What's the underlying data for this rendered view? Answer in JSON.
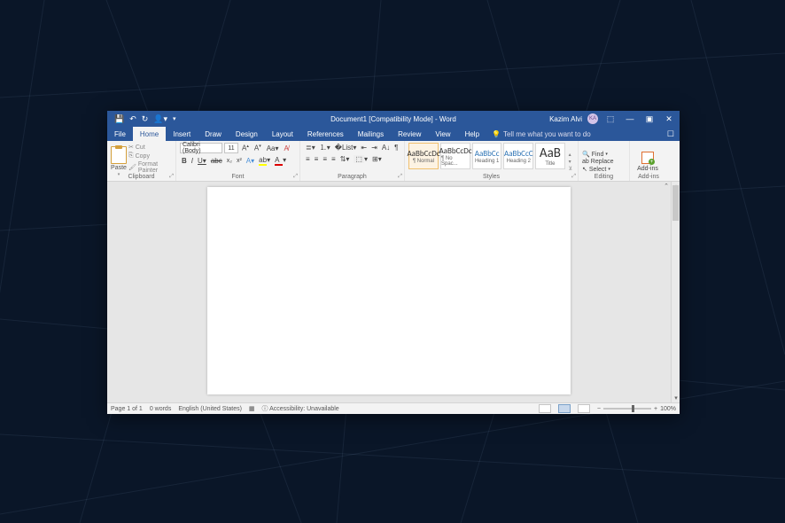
{
  "title": "Document1 [Compatibility Mode] - Word",
  "user": {
    "name": "Kazim Alvi",
    "initials": "KA"
  },
  "tabs": [
    "File",
    "Home",
    "Insert",
    "Draw",
    "Design",
    "Layout",
    "References",
    "Mailings",
    "Review",
    "View",
    "Help"
  ],
  "activeTab": "Home",
  "tellme": "Tell me what you want to do",
  "clipboard": {
    "label": "Clipboard",
    "paste": "Paste",
    "cut": "Cut",
    "copy": "Copy",
    "painter": "Format Painter"
  },
  "font": {
    "label": "Font",
    "name": "Calibri (Body)",
    "size": "11"
  },
  "paragraph": {
    "label": "Paragraph"
  },
  "styles": {
    "label": "Styles",
    "items": [
      {
        "preview": "AaBbCcDc",
        "name": "¶ Normal"
      },
      {
        "preview": "AaBbCcDc",
        "name": "¶ No Spac..."
      },
      {
        "preview": "AaBbCc",
        "name": "Heading 1"
      },
      {
        "preview": "AaBbCcC",
        "name": "Heading 2"
      },
      {
        "preview": "AaB",
        "name": "Title"
      }
    ]
  },
  "editing": {
    "label": "Editing",
    "find": "Find",
    "replace": "Replace",
    "select": "Select"
  },
  "addins": {
    "label": "Add-ins",
    "btn": "Add-ins"
  },
  "status": {
    "page": "Page 1 of 1",
    "words": "0 words",
    "lang": "English (United States)",
    "access": "Accessibility: Unavailable",
    "zoom": "100%"
  }
}
